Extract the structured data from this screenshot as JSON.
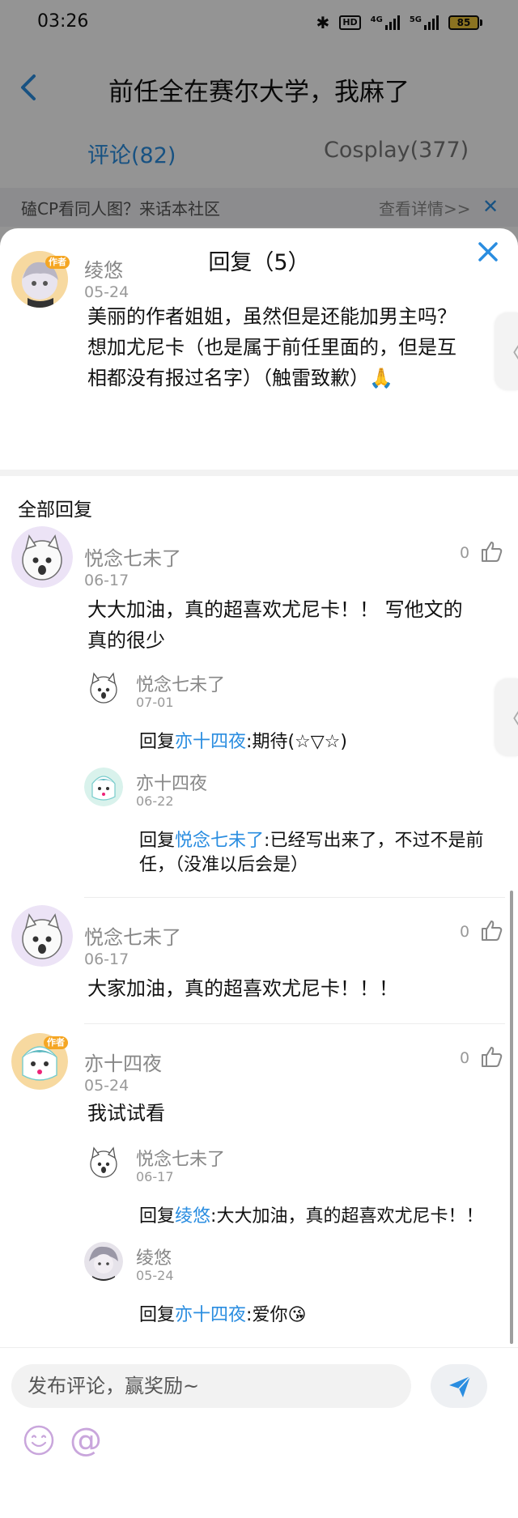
{
  "status_bar": {
    "time": "03:26",
    "hd": "HD",
    "net1": "4G",
    "net2": "5G",
    "battery": "85"
  },
  "header": {
    "title": "前任全在赛尔大学，我麻了"
  },
  "tabs": [
    {
      "label": "评论(82)"
    },
    {
      "label": "Cosplay(377)"
    }
  ],
  "banner": {
    "text": "磕CP看同人图？来话本社区",
    "link": "查看详情>>"
  },
  "sheet": {
    "title": "回复（5）",
    "original": {
      "user": "绫悠",
      "badge": "作者",
      "date": "05-24",
      "text_line1": "美丽的作者姐姐，虽然但是还能加男主吗？",
      "text_line2": "想加尤尼卡（也是属于前任里面的，但是互",
      "text_line3": "相都没有报过名字）（触雷致歉）🙏"
    },
    "all_replies_label": "全部回复",
    "replies": [
      {
        "user": "悦念七未了",
        "date": "06-17",
        "likes": "0",
        "text_line1": "大大加油，真的超喜欢尤尼卡！！ 写他文的",
        "text_line2": "真的很少",
        "sub": [
          {
            "user": "悦念七未了",
            "date": "07-01",
            "prefix": "回复",
            "target": "亦十四夜",
            "text": ":期待(☆▽☆)"
          },
          {
            "user": "亦十四夜",
            "date": "06-22",
            "prefix": "回复",
            "target": "悦念七未了",
            "text": ":已经写出来了，不过不是前",
            "text2": "任，（没准以后会是）"
          }
        ]
      },
      {
        "user": "悦念七未了",
        "date": "06-17",
        "likes": "0",
        "text_line1": "大家加油，真的超喜欢尤尼卡！！！"
      },
      {
        "user": "亦十四夜",
        "badge": "作者",
        "date": "05-24",
        "likes": "0",
        "text_line1": "我试试看",
        "sub": [
          {
            "user": "悦念七未了",
            "date": "06-17",
            "prefix": "回复",
            "target": "绫悠",
            "text": ":大大加油，真的超喜欢尤尼卡！！"
          },
          {
            "user": "绫悠",
            "date": "05-24",
            "prefix": "回复",
            "target": "亦十四夜",
            "text": ":爱你😘"
          }
        ]
      }
    ]
  },
  "composer": {
    "placeholder": "发布评论，赢奖励~",
    "at_symbol": "@"
  },
  "colors": {
    "accent": "#2a8de0",
    "badge": "#f5a623"
  },
  "icons": [
    "back-icon",
    "close-icon",
    "thumbs-up-icon",
    "send-icon",
    "emoji-icon",
    "at-icon",
    "chevron-left-icon"
  ]
}
